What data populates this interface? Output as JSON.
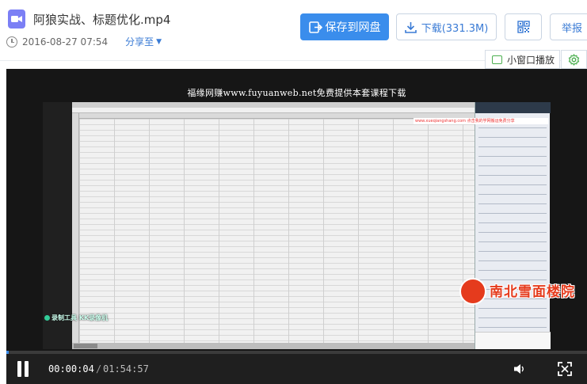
{
  "header": {
    "file_icon": "video-file-icon",
    "title": "阿狼实战、标题优化.mp4",
    "date": "2016-08-27 07:54",
    "share_label": "分享至"
  },
  "toolbar": {
    "save_label": "保存到网盘",
    "download_label": "下载(331.3M)",
    "qr_icon": "qr-code-icon",
    "report_label": "举报",
    "accent_color": "#3a8dec"
  },
  "player_options": {
    "mini_player_label": "小窗口播放",
    "settings_icon": "gear-icon"
  },
  "video": {
    "watermark_text": "福缘网赚www.fuyuanweb.net免费提供本套课程下载",
    "recorder_badge": "录制工具 KK录像机",
    "chat_link_text": "www.xueqiangshang.com 点击我的学网搬运免费分享",
    "logo_text": "南北雪面楼院",
    "progress": 0.0004
  },
  "controls": {
    "current_time": "00:00:04",
    "separator": "/",
    "total_time": "01:54:57"
  }
}
